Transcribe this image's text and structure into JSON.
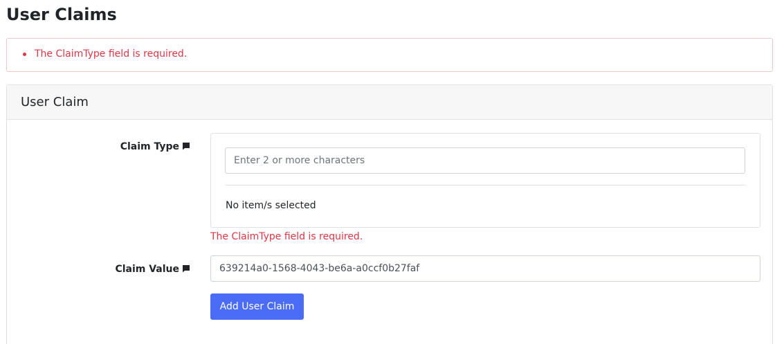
{
  "page": {
    "title": "User Claims"
  },
  "errors": {
    "summary": [
      "The ClaimType field is required."
    ]
  },
  "card": {
    "title": "User Claim"
  },
  "claim_type": {
    "label": "Claim Type",
    "icon": "comment-icon",
    "input_placeholder": "Enter 2 or more characters",
    "input_value": "",
    "empty_text": "No item/s selected",
    "error": "The ClaimType field is required."
  },
  "claim_value": {
    "label": "Claim Value",
    "icon": "comment-icon",
    "value": "639214a0-1568-4043-be6a-a0ccf0b27faf"
  },
  "actions": {
    "add_label": "Add User Claim"
  },
  "colors": {
    "error": "#dc3545",
    "primary": "#4a6cf7",
    "border": "#dee2e6",
    "header_bg": "#f7f7f7"
  }
}
